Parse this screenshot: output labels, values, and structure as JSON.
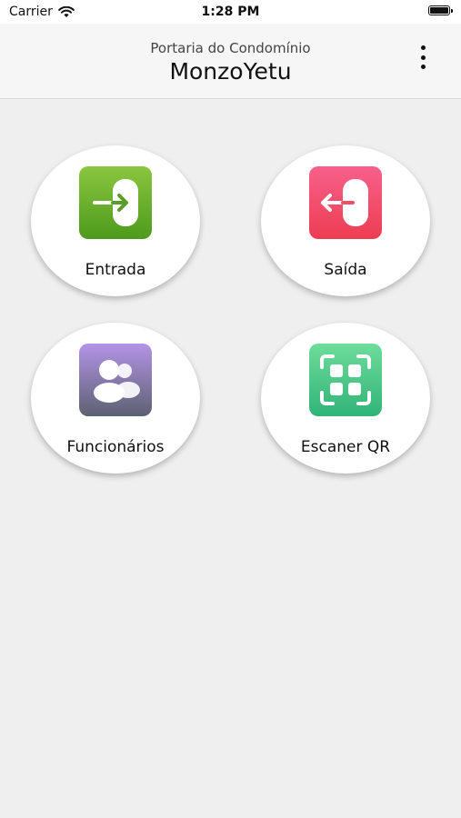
{
  "status_bar": {
    "carrier": "Carrier",
    "time": "1:28 PM"
  },
  "header": {
    "subtitle": "Portaria do Condomínio",
    "title": "MonzoYetu",
    "menu_icon": "more-vertical-icon"
  },
  "tiles": [
    {
      "label": "Entrada",
      "icon": "entry-door-icon",
      "gradient": [
        "#8ac63f",
        "#4d9a1c"
      ]
    },
    {
      "label": "Saída",
      "icon": "exit-door-icon",
      "gradient": [
        "#f7608a",
        "#ee3d52"
      ]
    },
    {
      "label": "Funcionários",
      "icon": "users-icon",
      "gradient": [
        "#b394e6",
        "#5d6172"
      ]
    },
    {
      "label": "Escaner QR",
      "icon": "qr-scan-icon",
      "gradient": [
        "#6fdc9b",
        "#2fb477"
      ]
    }
  ]
}
